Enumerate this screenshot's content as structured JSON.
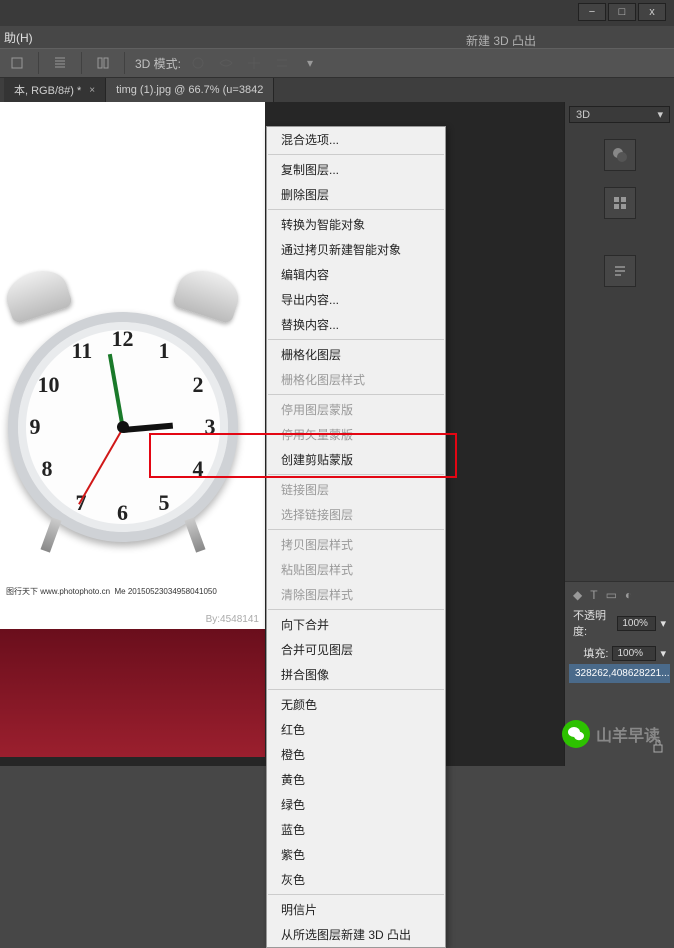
{
  "window": {
    "btns": {
      "min": "−",
      "max": "□",
      "close": "x"
    }
  },
  "menubar": {
    "help": "助(H)"
  },
  "toolbar": {
    "mode_label": "3D 模式:",
    "dropdown_selected": "3D"
  },
  "top_label": "新建 3D 凸出",
  "tabs": [
    {
      "label": "本, RGB/8#) *",
      "active": false
    },
    {
      "label": "timg (1).jpg @ 66.7% (u=3842",
      "active": true
    }
  ],
  "clock": {
    "numbers": [
      "1",
      "2",
      "3",
      "4",
      "5",
      "6",
      "7",
      "8",
      "9",
      "10",
      "11",
      "12"
    ],
    "watermark_left": "图行天下 www.photophoto.cn",
    "watermark_id": "Me 20150523034958041050",
    "watermark_by": "By:4548141"
  },
  "context_menu": {
    "items": [
      {
        "label": "混合选项...",
        "disabled": false
      },
      {
        "sep": true
      },
      {
        "label": "复制图层...",
        "disabled": false
      },
      {
        "label": "删除图层",
        "disabled": false
      },
      {
        "sep": true
      },
      {
        "label": "转换为智能对象",
        "disabled": false
      },
      {
        "label": "通过拷贝新建智能对象",
        "disabled": false
      },
      {
        "label": "编辑内容",
        "disabled": false
      },
      {
        "label": "导出内容...",
        "disabled": false
      },
      {
        "label": "替换内容...",
        "disabled": false
      },
      {
        "sep": true
      },
      {
        "label": "栅格化图层",
        "disabled": false
      },
      {
        "label": "栅格化图层样式",
        "disabled": true
      },
      {
        "sep": true
      },
      {
        "label": "停用图层蒙版",
        "disabled": true
      },
      {
        "label": "停用矢量蒙版",
        "disabled": true
      },
      {
        "label": "创建剪贴蒙版",
        "disabled": false,
        "highlighted": true
      },
      {
        "sep": true
      },
      {
        "label": "链接图层",
        "disabled": true
      },
      {
        "label": "选择链接图层",
        "disabled": true
      },
      {
        "sep": true
      },
      {
        "label": "拷贝图层样式",
        "disabled": true
      },
      {
        "label": "粘贴图层样式",
        "disabled": true
      },
      {
        "label": "清除图层样式",
        "disabled": true
      },
      {
        "sep": true
      },
      {
        "label": "向下合并",
        "disabled": false
      },
      {
        "label": "合并可见图层",
        "disabled": false
      },
      {
        "label": "拼合图像",
        "disabled": false
      },
      {
        "sep": true
      },
      {
        "label": "无颜色",
        "disabled": false
      },
      {
        "label": "红色",
        "disabled": false
      },
      {
        "label": "橙色",
        "disabled": false
      },
      {
        "label": "黄色",
        "disabled": false
      },
      {
        "label": "绿色",
        "disabled": false
      },
      {
        "label": "蓝色",
        "disabled": false
      },
      {
        "label": "紫色",
        "disabled": false
      },
      {
        "label": "灰色",
        "disabled": false
      },
      {
        "sep": true
      },
      {
        "label": "明信片",
        "disabled": false
      },
      {
        "label": "从所选图层新建 3D 凸出",
        "disabled": false
      }
    ]
  },
  "panels": {
    "opacity_label": "不透明度:",
    "opacity_value": "100%",
    "fill_label": "填充:",
    "fill_value": "100%",
    "layer_name": "328262,408628221..."
  },
  "wechat": {
    "text": "山羊早读"
  }
}
